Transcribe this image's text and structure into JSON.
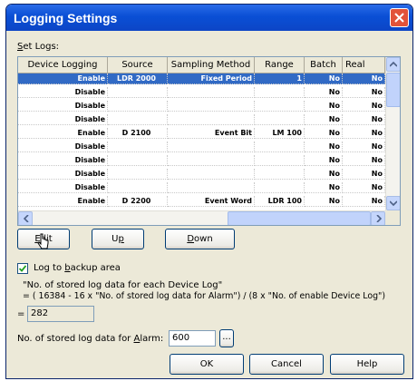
{
  "window": {
    "title": "Logging Settings"
  },
  "set_logs_label": {
    "prefix": "S",
    "rest": "et Logs:"
  },
  "table": {
    "columns": [
      "Device Logging",
      "Source",
      "Sampling Method",
      "Range",
      "Batch",
      "Real Time"
    ],
    "rows": [
      [
        "Enable",
        "LDR 2000",
        "Fixed Period",
        "1",
        "No",
        "No"
      ],
      [
        "Disable",
        "",
        "",
        "",
        "No",
        "No"
      ],
      [
        "Disable",
        "",
        "",
        "",
        "No",
        "No"
      ],
      [
        "Disable",
        "",
        "",
        "",
        "No",
        "No"
      ],
      [
        "Enable",
        "D 2100",
        "Event Bit",
        "LM 100",
        "No",
        "No"
      ],
      [
        "Disable",
        "",
        "",
        "",
        "No",
        "No"
      ],
      [
        "Disable",
        "",
        "",
        "",
        "No",
        "No"
      ],
      [
        "Disable",
        "",
        "",
        "",
        "No",
        "No"
      ],
      [
        "Disable",
        "",
        "",
        "",
        "No",
        "No"
      ],
      [
        "Enable",
        "D 2200",
        "Event Word",
        "LDR 100",
        "No",
        "No"
      ]
    ],
    "selected_row": 0
  },
  "buttons": {
    "edit": {
      "u": "E",
      "rest": "dit"
    },
    "up": {
      "pre": "U",
      "u": "p"
    },
    "down": {
      "u": "D",
      "rest": "own"
    },
    "ok": "OK",
    "cancel": "Cancel",
    "help": "Help",
    "browse": "..."
  },
  "backup": {
    "checked": true,
    "pre": "Log to ",
    "u": "b",
    "rest": "ackup area"
  },
  "formula": {
    "line1": "\"No. of stored log data for each Device Log\"",
    "line2": "= ( 16384 - 16 x \"No. of stored log data for Alarm\") / (8 x \"No. of enable Device Log\")",
    "eq": "=",
    "result": "282"
  },
  "alarm": {
    "pre": "No. of stored log data for ",
    "u": "A",
    "rest": "larm:",
    "value": "600"
  },
  "colors": {
    "titlebar": "#0a4fd5",
    "selection": "#316ac5",
    "face": "#ece9d8",
    "close": "#e2533a"
  }
}
